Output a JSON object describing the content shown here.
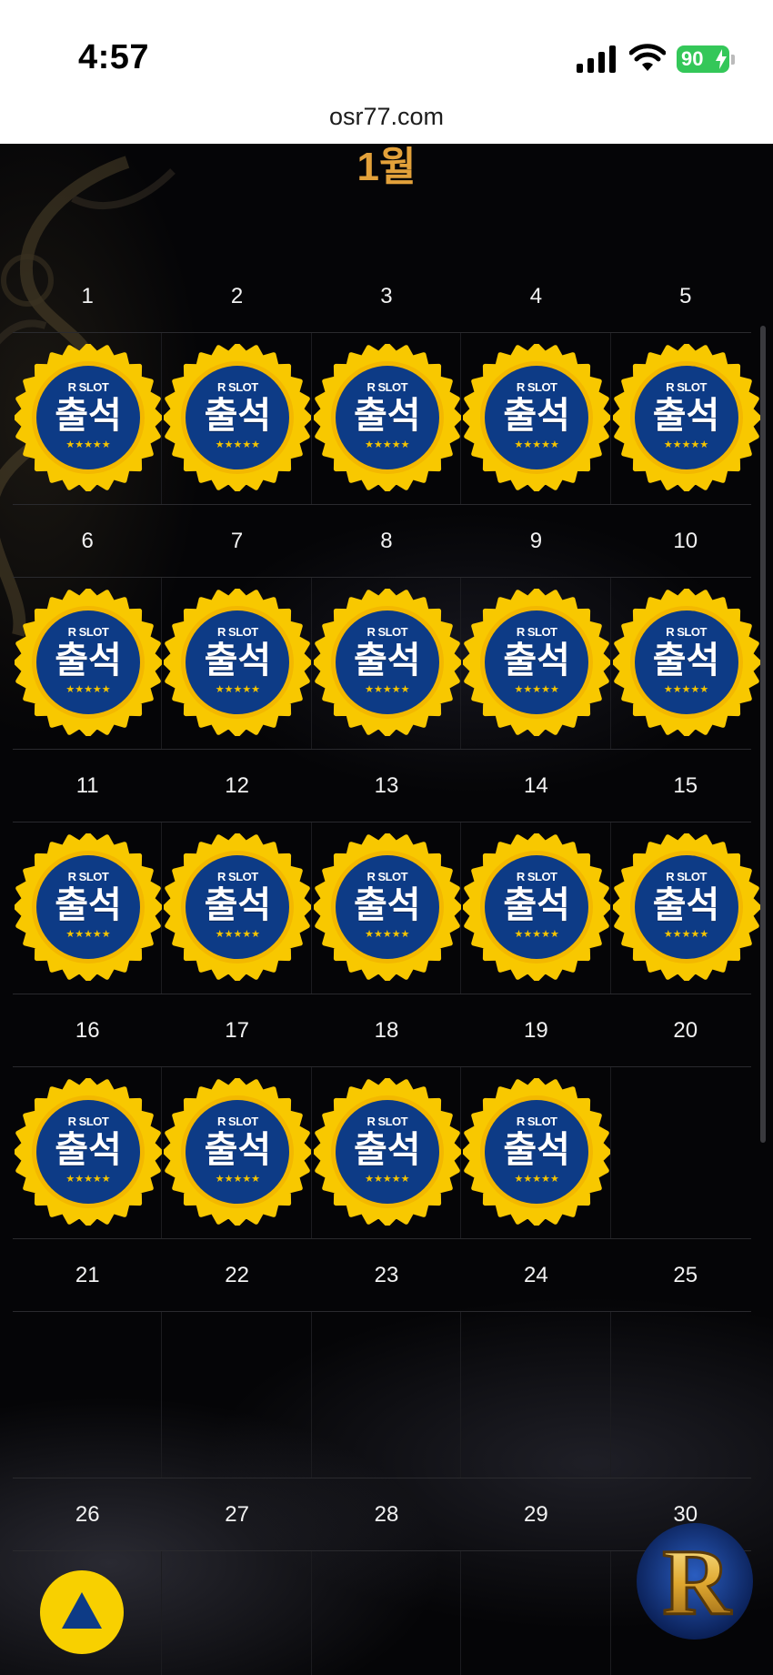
{
  "status_bar": {
    "time": "4:57",
    "battery": "90",
    "icons": [
      "signal-bars-icon",
      "wifi-icon",
      "battery-charging-icon"
    ]
  },
  "browser": {
    "url": "osr77.com"
  },
  "calendar": {
    "month_title": "1월",
    "badge": {
      "brand": "R SLOT",
      "label": "출석",
      "stars": "★★★★★",
      "colors": {
        "ring": "#f8c800",
        "face": "#0d3b86",
        "stars": "#f5c400"
      }
    },
    "weeks": [
      {
        "days": [
          "1",
          "2",
          "3",
          "4",
          "5"
        ],
        "attended": [
          true,
          true,
          true,
          true,
          true
        ]
      },
      {
        "days": [
          "6",
          "7",
          "8",
          "9",
          "10"
        ],
        "attended": [
          true,
          true,
          true,
          true,
          true
        ]
      },
      {
        "days": [
          "11",
          "12",
          "13",
          "14",
          "15"
        ],
        "attended": [
          true,
          true,
          true,
          true,
          true
        ]
      },
      {
        "days": [
          "16",
          "17",
          "18",
          "19",
          "20"
        ],
        "attended": [
          true,
          true,
          true,
          true,
          false
        ]
      },
      {
        "days": [
          "21",
          "22",
          "23",
          "24",
          "25"
        ],
        "attended": [
          false,
          false,
          false,
          false,
          false
        ]
      },
      {
        "days": [
          "26",
          "27",
          "28",
          "29",
          "30"
        ],
        "attended": [
          false,
          false,
          false,
          false,
          false
        ]
      }
    ]
  },
  "floating": {
    "scroll_top_icon": "up-triangle-icon",
    "logo": "R"
  },
  "colors": {
    "month_title": "#e3a13a",
    "accent_yellow": "#f8d000",
    "background": "#050507"
  }
}
